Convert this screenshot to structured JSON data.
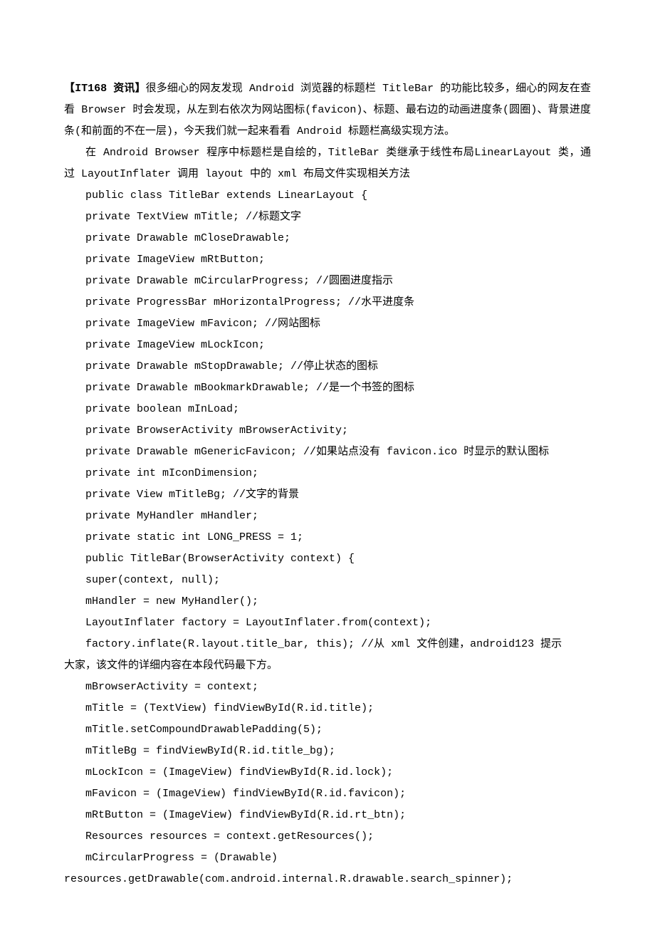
{
  "intro": {
    "tag": "【IT168 资讯】",
    "p1": "很多细心的网友发现 Android 浏览器的标题栏 TitleBar 的功能比较多，细心的网友在查看 Browser 时会发现，从左到右依次为网站图标(favicon)、标题、最右边的动画进度条(圆圈)、背景进度条(和前面的不在一层)，今天我们就一起来看看 Android 标题栏高级实现方法。",
    "p2": "在 Android Browser 程序中标题栏是自绘的，TitleBar 类继承于线性布局LinearLayout 类，通过 LayoutInflater 调用 layout 中的 xml 布局文件实现相关方法"
  },
  "code": {
    "l01": "public class TitleBar extends LinearLayout {",
    "l02": "private TextView mTitle; //标题文字",
    "l03": "private Drawable mCloseDrawable;",
    "l04": "private ImageView mRtButton;",
    "l05": "private Drawable mCircularProgress; //圆圈进度指示",
    "l06": "private ProgressBar mHorizontalProgress; //水平进度条",
    "l07": "private ImageView mFavicon; //网站图标",
    "l08": "private ImageView mLockIcon;",
    "l09": "private Drawable mStopDrawable; //停止状态的图标",
    "l10": "private Drawable mBookmarkDrawable; //是一个书签的图标",
    "l11": "private boolean mInLoad;",
    "l12": "private BrowserActivity mBrowserActivity;",
    "l13": "private Drawable mGenericFavicon; //如果站点没有 favicon.ico 时显示的默认图标",
    "l14": "private int mIconDimension;",
    "l15": "private View mTitleBg; //文字的背景",
    "l16": "private MyHandler mHandler;",
    "l17": "private static int LONG_PRESS = 1;",
    "l18": "public TitleBar(BrowserActivity context) {",
    "l19": "super(context, null);",
    "l20": "mHandler = new MyHandler();",
    "l21": "LayoutInflater factory = LayoutInflater.from(context);",
    "l22a": "factory.inflate(R.layout.title_bar, this); //从 xml 文件创建，android123 提示",
    "l22b": "大家，该文件的详细内容在本段代码最下方。",
    "l23": "mBrowserActivity = context;",
    "l24": "mTitle = (TextView) findViewById(R.id.title);",
    "l25": "mTitle.setCompoundDrawablePadding(5);",
    "l26": "mTitleBg = findViewById(R.id.title_bg);",
    "l27": "mLockIcon = (ImageView) findViewById(R.id.lock);",
    "l28": "mFavicon = (ImageView) findViewById(R.id.favicon);",
    "l29": "mRtButton = (ImageView) findViewById(R.id.rt_btn);",
    "l30": "Resources resources = context.getResources();",
    "l31": "mCircularProgress = (Drawable)",
    "l32": "resources.getDrawable(com.android.internal.R.drawable.search_spinner);"
  }
}
